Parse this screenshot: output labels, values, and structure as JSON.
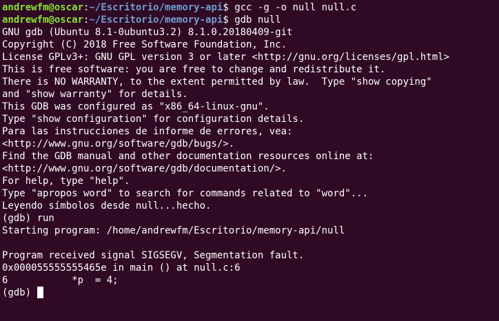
{
  "colors": {
    "background": "#300a24",
    "foreground": "#ffffff",
    "prompt_user": "#8ae234",
    "prompt_path": "#729fcf"
  },
  "prompts": [
    {
      "user": "andrewfm@oscar",
      "sep": ":",
      "path": "~/Escritorio/memory-api",
      "symbol": "$",
      "command": "gcc -g -o null null.c"
    },
    {
      "user": "andrewfm@oscar",
      "sep": ":",
      "path": "~/Escritorio/memory-api",
      "symbol": "$",
      "command": "gdb null"
    }
  ],
  "output": [
    "GNU gdb (Ubuntu 8.1-0ubuntu3.2) 8.1.0.20180409-git",
    "Copyright (C) 2018 Free Software Foundation, Inc.",
    "License GPLv3+: GNU GPL version 3 or later <http://gnu.org/licenses/gpl.html>",
    "This is free software: you are free to change and redistribute it.",
    "There is NO WARRANTY, to the extent permitted by law.  Type \"show copying\"",
    "and \"show warranty\" for details.",
    "This GDB was configured as \"x86_64-linux-gnu\".",
    "Type \"show configuration\" for configuration details.",
    "Para las instrucciones de informe de errores, vea:",
    "<http://www.gnu.org/software/gdb/bugs/>.",
    "Find the GDB manual and other documentation resources online at:",
    "<http://www.gnu.org/software/gdb/documentation/>.",
    "For help, type \"help\".",
    "Type \"apropos word\" to search for commands related to \"word\"...",
    "Leyendo símbolos desde null...hecho.",
    "(gdb) run",
    "Starting program: /home/andrewfm/Escritorio/memory-api/null",
    "",
    "Program received signal SIGSEGV, Segmentation fault.",
    "0x000055555555465e in main () at null.c:6",
    "6\t    *p  = 4;"
  ],
  "current_prompt": "(gdb) "
}
